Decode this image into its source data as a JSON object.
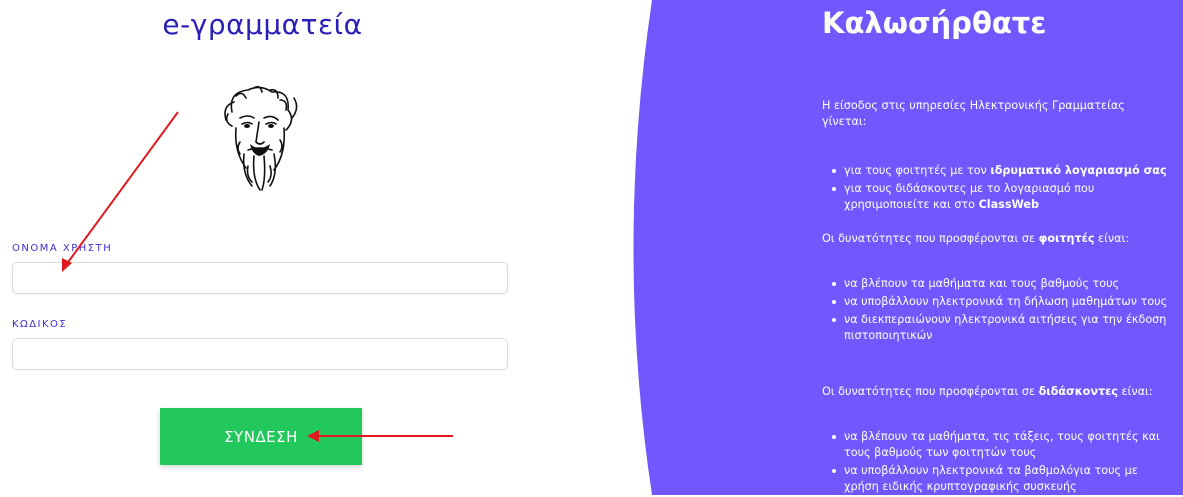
{
  "left": {
    "title": "e-γραμματεία",
    "username_label": "ΟΝΟΜΑ ΧΡΗΣΤΗ",
    "username_value": "",
    "password_label": "ΚΩΔΙΚΟΣ",
    "password_value": "",
    "login_button": "ΣΥΝΔΕΣΗ"
  },
  "right": {
    "title": "Καλωσήρθατε",
    "intro": "Η είσοδος στις υπηρεσίες Ηλεκτρονικής Γραμματείας γίνεται:",
    "access_items": [
      {
        "pre": "για τους φοιτητές με τον ",
        "bold": "ιδρυματικό λογαριασμό σας",
        "post": ""
      },
      {
        "pre": "για τους διδάσκοντες με το λογαριασμό που χρησιμοποιείτε και στο ",
        "bold": "ClassWeb",
        "post": ""
      }
    ],
    "students_heading": {
      "pre": "Οι δυνατότητες που προσφέρονται σε ",
      "bold": "φοιτητές",
      "post": " είναι:"
    },
    "student_items": [
      "να βλέπουν τα μαθήματα και τους βαθμούς τους",
      "να υποβάλλουν ηλεκτρονικά τη δήλωση μαθημάτων τους",
      "να διεκπεραιώνουν ηλεκτρονικά αιτήσεις για την έκδοση πιστοποιητικών"
    ],
    "teachers_heading": {
      "pre": "Οι δυνατότητες που προσφέρονται σε ",
      "bold": "διδάσκοντες",
      "post": " είναι:"
    },
    "teacher_items": [
      "να βλέπουν τα μαθήματα, τις τάξεις, τους φοιτητές και τους βαθμούς των φοιτητών τους",
      "να υποβάλλουν ηλεκτρονικά τα βαθμολόγια τους με χρήση ειδικής κρυπτογραφικής συσκευής"
    ]
  },
  "colors": {
    "title": "#2a1fb8",
    "label": "#3b2fd0",
    "panel": "#7158fe",
    "button": "#22c85c",
    "annotation": "#e0191e"
  },
  "icons": {
    "logo": "philosopher-portrait-logo"
  }
}
